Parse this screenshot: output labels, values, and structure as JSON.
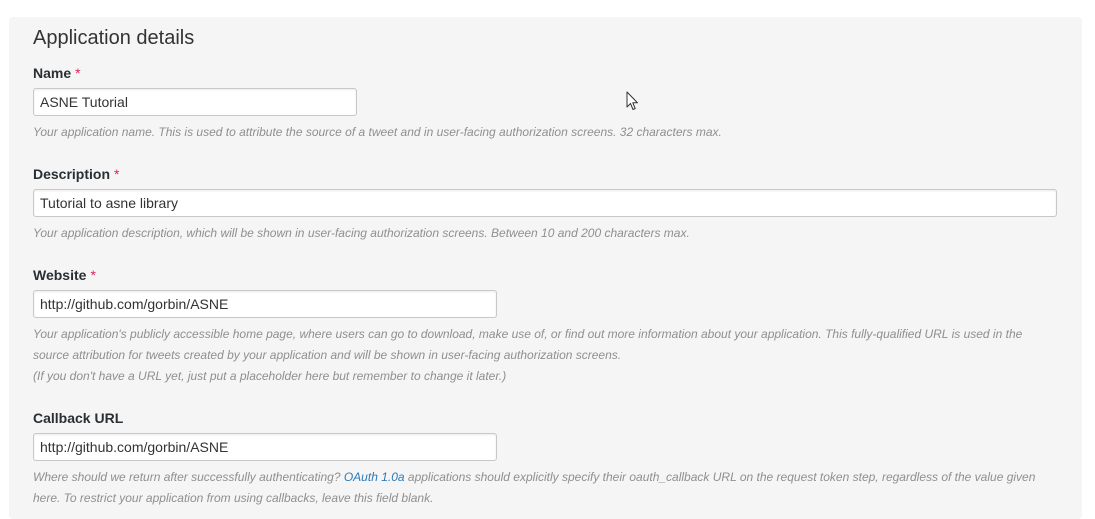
{
  "section": {
    "title": "Application details"
  },
  "name": {
    "label": "Name",
    "required_mark": "*",
    "value": "ASNE Tutorial",
    "help": "Your application name. This is used to attribute the source of a tweet and in user-facing authorization screens. 32 characters max."
  },
  "description": {
    "label": "Description",
    "required_mark": "*",
    "value": "Tutorial to asne library",
    "help": "Your application description, which will be shown in user-facing authorization screens. Between 10 and 200 characters max."
  },
  "website": {
    "label": "Website",
    "required_mark": "*",
    "value": "http://github.com/gorbin/ASNE",
    "help_line1": "Your application's publicly accessible home page, where users can go to download, make use of, or find out more information about your application. This fully-qualified URL is used in the",
    "help_line2": "source attribution for tweets created by your application and will be shown in user-facing authorization screens.",
    "help_line3": "(If you don't have a URL yet, just put a placeholder here but remember to change it later.)"
  },
  "callback": {
    "label": "Callback URL",
    "value": "http://github.com/gorbin/ASNE",
    "help_prefix": "Where should we return after successfully authenticating?",
    "help_link": "OAuth 1.0a",
    "help_suffix": "applications should explicitly specify their oauth_callback URL on the request token step, regardless of the value given",
    "help_line2": "here. To restrict your application from using callbacks, leave this field blank."
  },
  "icons": {
    "cursor": "mouse-pointer-icon"
  },
  "colors": {
    "required": "#e0245e",
    "link": "#2b7bb9",
    "help_text": "#8f8f8f",
    "panel_bg": "#f5f5f5"
  }
}
